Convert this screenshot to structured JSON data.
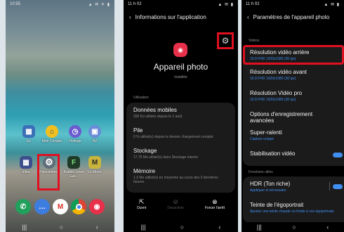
{
  "home": {
    "status_time": "10:55",
    "status_icons": "▲ ✉ ✈ ▮",
    "apps_row1": [
      {
        "icon": "gallery-folder-icon",
        "label": "Go",
        "color": "#3b6fb8"
      },
      {
        "icon": "home-icon",
        "label": "Mon Compte",
        "color": "#f0c020"
      },
      {
        "icon": "clock-icon",
        "label": "Horloge",
        "color": "#6b5cd0"
      },
      {
        "icon": "folder-icon",
        "label": "NZ",
        "color": "#6a8bd8"
      }
    ],
    "apps_row2": [
      {
        "icon": "apps-folder-icon",
        "label": "Infos",
        "color": "#3c4f8c"
      },
      {
        "icon": "settings-icon",
        "label": "Para-mètres",
        "color": "#5f6d79"
      },
      {
        "icon": "bubble-level-icon",
        "label": "Bubble Level Gal...",
        "color": "#1f3a26"
      },
      {
        "icon": "moov-icon",
        "label": "Le Moov'",
        "color": "#c9b43c"
      }
    ],
    "dock": [
      {
        "icon": "phone-icon",
        "color": "#21a05b"
      },
      {
        "icon": "messages-icon",
        "color": "#3e7de0"
      },
      {
        "icon": "gmail-icon",
        "color": "#ffffff"
      },
      {
        "icon": "chrome-icon",
        "color": "#ffffff"
      },
      {
        "icon": "camera-icon",
        "color": "#e8304a"
      }
    ]
  },
  "appinfo": {
    "status_time": "11 h 02",
    "header_title": "Informations sur l'application",
    "app_name": "Appareil photo",
    "app_state": "Installée",
    "section_label": "Utilisation",
    "items": [
      {
        "title": "Données mobiles",
        "sub": "256 Ko utilisés depuis le 1 août"
      },
      {
        "title": "Pile",
        "sub": "0 % utilisé(s) depuis le dernier chargement complet"
      },
      {
        "title": "Stockage",
        "sub": "17,75 Mo utilisé(s) dans Stockage interne"
      },
      {
        "title": "Mémoire",
        "sub": "1,3 Mo utilisé(s) en moyenne au cours des 3 dernières heures"
      }
    ],
    "actions": [
      "Ouvrir",
      "Désactiver",
      "Forcer l'arrêt"
    ]
  },
  "camsettings": {
    "status_time": "11 h 02",
    "header_title": "Paramètres de l'appareil photo",
    "section_video": "Vidéos",
    "items": [
      {
        "title": "Résolution vidéo arrière",
        "sub": "16:9 FHD 1920x1080 (30 ips)"
      },
      {
        "title": "Résolution vidéo avant",
        "sub": "16:9 FHD 1920x1080 (30 ips)"
      },
      {
        "title": "Résolution Vidéo pro",
        "sub": "16:9 FHD 1920x1080 (30 ips)"
      },
      {
        "title": "Options d'enregistrement avancées",
        "sub": ""
      },
      {
        "title": "Super-ralenti",
        "sub": "Capture unique"
      },
      {
        "title": "Stabilisation vidéo",
        "sub": ""
      }
    ],
    "section_useful": "Fonctions utiles",
    "useful": [
      {
        "title": "HDR (Ton riche)",
        "sub": "Appliquer si nécessaire"
      },
      {
        "title": "Teinte de l'égoportrait",
        "sub": "Ajoutez une teinte chaude ou froide à vos égoportraits"
      }
    ],
    "accent": "#3f8ef0",
    "highlight": "#e01020"
  }
}
